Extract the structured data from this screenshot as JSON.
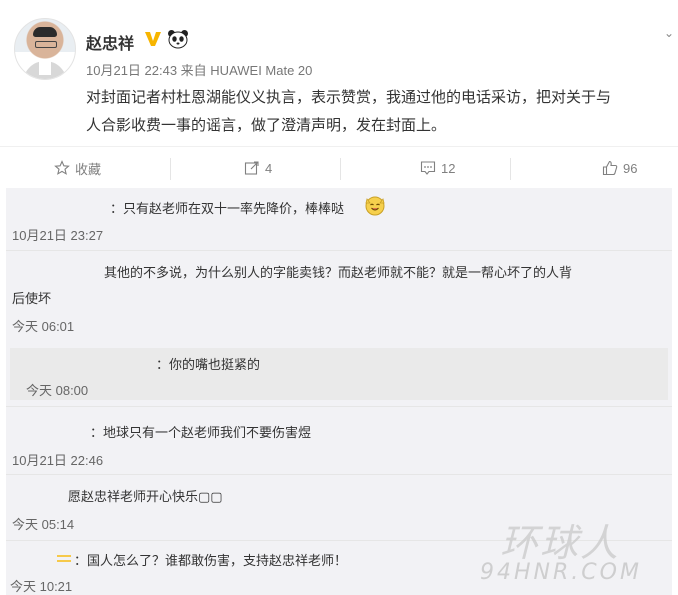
{
  "post": {
    "author_name": "赵忠祥",
    "meta": "10月21日 22:43 来自 HUAWEI Mate 20",
    "body_line1": "对封面记者村杜恩湖能仪义执言，表示赞赏，我通过他的电话采访，把对关于与",
    "body_line2": "人合影收费一事的谣言，做了澄清声明，发在封面上。",
    "corner_icon": "chevron-down-icon"
  },
  "actions": {
    "favorite_label": "收藏",
    "repost_count": "4",
    "comment_count": "12",
    "like_count": "96"
  },
  "comments": [
    {
      "text": "：只有赵老师在双十一率先降价，棒棒哒",
      "emoji": "smiling-face-emoji",
      "time": "10月21日 23:27"
    },
    {
      "text_line1": "其他的不多说，为什么别人的字能卖钱？而赵老师就不能？就是一帮心坏了的人背",
      "text_line2": "后使坏",
      "time": "今天 06:01"
    },
    {
      "text": "：你的嘴也挺紧的",
      "time": "今天 08:00"
    },
    {
      "text": "：地球只有一个赵老师我们不要伤害煜",
      "time": "10月21日 22:46"
    },
    {
      "text": "愿赵忠祥老师开心快乐▢▢",
      "time": "今天 05:14"
    },
    {
      "text": "：国人怎么了？谁都敢伤害，支持赵忠祥老师！",
      "time": "今天 10:21"
    }
  ],
  "watermark": {
    "line1": "环球人",
    "line2": "94HNR.COM"
  },
  "colors": {
    "badge_yellow": "#f7b500",
    "comment_bg": "#f2f2f5",
    "reply_bg": "#eaeaea",
    "meta_gray": "#777777"
  }
}
